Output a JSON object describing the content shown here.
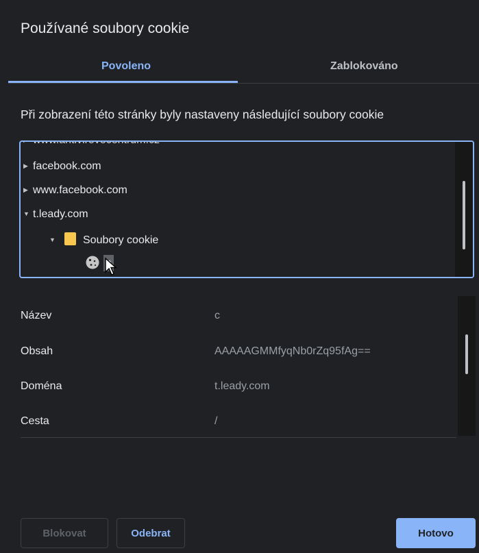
{
  "dialog": {
    "title": "Používané soubory cookie"
  },
  "tabs": [
    {
      "label": "Povoleno",
      "selected": true
    },
    {
      "label": "Zablokováno",
      "selected": false
    }
  ],
  "description": "Při zobrazení této stránky byly nastaveny následující soubory cookie",
  "tree": {
    "items": [
      {
        "label": "www.antivirovecentrum.cz",
        "expanded": false
      },
      {
        "label": "facebook.com",
        "expanded": false
      },
      {
        "label": "www.facebook.com",
        "expanded": false
      },
      {
        "label": "t.leady.com",
        "expanded": true
      },
      {
        "label": "Soubory cookie",
        "expanded": true,
        "icon": "folder-icon"
      }
    ],
    "selected_cookie": {
      "label": "c",
      "icon": "cookie-icon"
    }
  },
  "details": [
    {
      "label": "Název",
      "value": "c"
    },
    {
      "label": "Obsah",
      "value": "AAAAAGMMfyqNb0rZq95fAg=="
    },
    {
      "label": "Doména",
      "value": "t.leady.com"
    },
    {
      "label": "Cesta",
      "value": "/"
    }
  ],
  "buttons": {
    "block": "Blokovat",
    "remove": "Odebrat",
    "done": "Hotovo"
  },
  "colors": {
    "background": "#202124",
    "accent": "#8ab4f8",
    "folder": "#f9c74f"
  }
}
